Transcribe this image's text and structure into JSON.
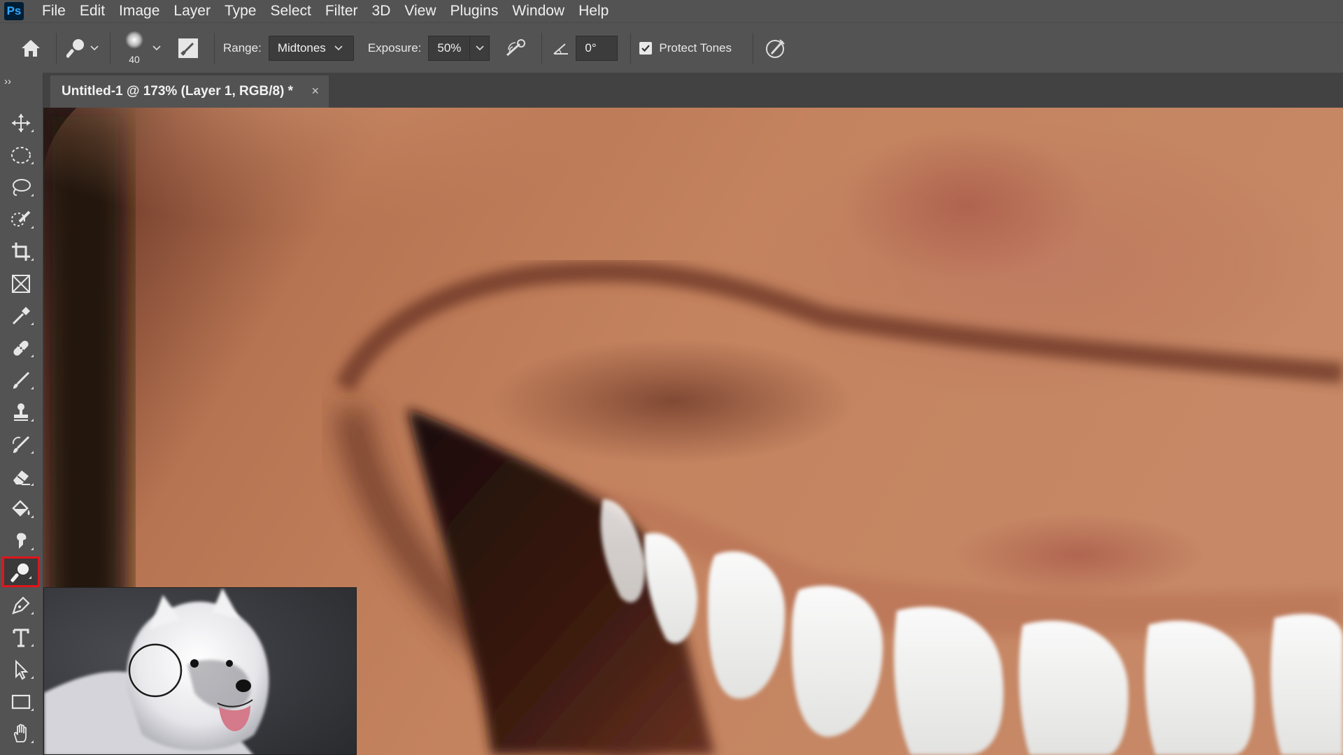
{
  "app": {
    "logo_text": "Ps",
    "menu": [
      "File",
      "Edit",
      "Image",
      "Layer",
      "Type",
      "Select",
      "Filter",
      "3D",
      "View",
      "Plugins",
      "Window",
      "Help"
    ]
  },
  "options_bar": {
    "brush_size": "40",
    "range_label": "Range:",
    "range_value": "Midtones",
    "exposure_label": "Exposure:",
    "exposure_value": "50%",
    "angle_value": "0°",
    "protect_tones_label": "Protect Tones",
    "protect_tones_checked": true
  },
  "document": {
    "tab_title": "Untitled-1 @ 173% (Layer 1, RGB/8) *",
    "close_glyph": "×"
  },
  "toolbar": {
    "collapse_glyph": "››",
    "selected_tool": "dodge-tool",
    "tools": [
      "move",
      "elliptical-marquee",
      "lasso",
      "quick-selection",
      "crop",
      "frame",
      "eyedropper",
      "spot-healing",
      "brush",
      "clone-stamp",
      "history-brush",
      "eraser",
      "paint-bucket",
      "smudge",
      "dodge",
      "pen",
      "type",
      "path-selection",
      "rectangle",
      "hand"
    ]
  },
  "colors": {
    "accent_selected": "#e0151b",
    "panel_bg": "#535353",
    "dark_bg": "#282828"
  }
}
